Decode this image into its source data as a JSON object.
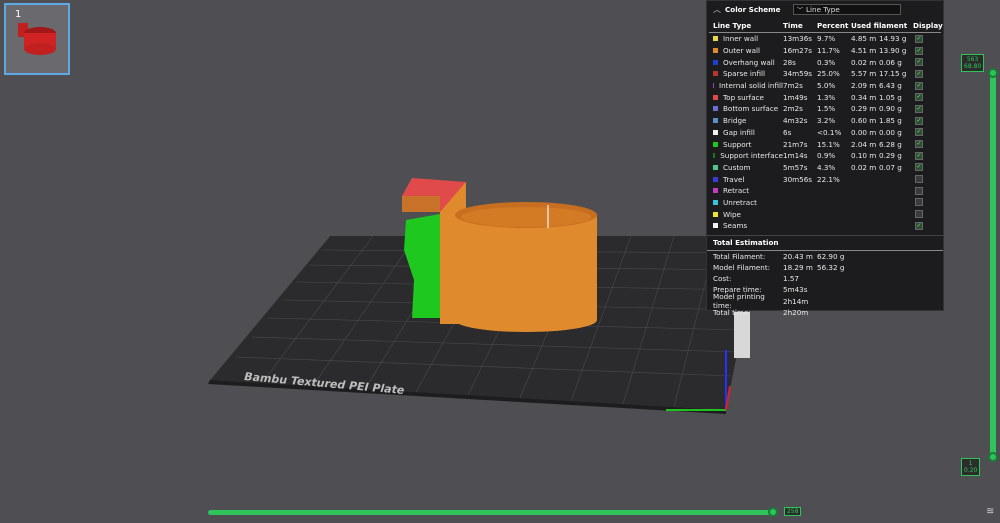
{
  "thumbnail": {
    "plate_number": "1"
  },
  "bed": {
    "label": "Bambu Textured PEI Plate"
  },
  "panel": {
    "color_scheme_label": "Color Scheme",
    "color_scheme_value": "Line Type",
    "columns": {
      "type": "Line Type",
      "time": "Time",
      "percent": "Percent",
      "filament": "Used filament",
      "display": "Display"
    },
    "rows": [
      {
        "name": "Inner wall",
        "time": "13m36s",
        "pct": "9.7%",
        "m": "4.85 m",
        "g": "14.93 g",
        "color": "#e8d84a",
        "on": true
      },
      {
        "name": "Outer wall",
        "time": "16m27s",
        "pct": "11.7%",
        "m": "4.51 m",
        "g": "13.90 g",
        "color": "#e28a2f",
        "on": true
      },
      {
        "name": "Overhang wall",
        "time": "28s",
        "pct": "0.3%",
        "m": "0.02 m",
        "g": "0.06 g",
        "color": "#1f3fcf",
        "on": true
      },
      {
        "name": "Sparse infill",
        "time": "34m59s",
        "pct": "25.0%",
        "m": "5.57 m",
        "g": "17.15 g",
        "color": "#b8322e",
        "on": true
      },
      {
        "name": "Internal solid infill",
        "time": "7m2s",
        "pct": "5.0%",
        "m": "2.09 m",
        "g": "6.43 g",
        "color": "#a23ec4",
        "on": true
      },
      {
        "name": "Top surface",
        "time": "1m49s",
        "pct": "1.3%",
        "m": "0.34 m",
        "g": "1.05 g",
        "color": "#e04a4a",
        "on": true
      },
      {
        "name": "Bottom surface",
        "time": "2m2s",
        "pct": "1.5%",
        "m": "0.29 m",
        "g": "0.90 g",
        "color": "#6c6cd8",
        "on": true
      },
      {
        "name": "Bridge",
        "time": "4m32s",
        "pct": "3.2%",
        "m": "0.60 m",
        "g": "1.85 g",
        "color": "#5c8fc8",
        "on": true
      },
      {
        "name": "Gap infill",
        "time": "6s",
        "pct": "<0.1%",
        "m": "0.00 m",
        "g": "0.00 g",
        "color": "#f2f2f2",
        "on": true
      },
      {
        "name": "Support",
        "time": "21m7s",
        "pct": "15.1%",
        "m": "2.04 m",
        "g": "6.28 g",
        "color": "#1ec81e",
        "on": true
      },
      {
        "name": "Support interface",
        "time": "1m14s",
        "pct": "0.9%",
        "m": "0.10 m",
        "g": "0.29 g",
        "color": "#1a7a1a",
        "on": true
      },
      {
        "name": "Custom",
        "time": "5m57s",
        "pct": "4.3%",
        "m": "0.02 m",
        "g": "0.07 g",
        "color": "#4fc88a",
        "on": true
      },
      {
        "name": "Travel",
        "time": "30m56s",
        "pct": "22.1%",
        "m": "",
        "g": "",
        "color": "#3a3ad8",
        "on": false
      },
      {
        "name": "Retract",
        "time": "",
        "pct": "",
        "m": "",
        "g": "",
        "color": "#c43ac4",
        "on": false
      },
      {
        "name": "Unretract",
        "time": "",
        "pct": "",
        "m": "",
        "g": "",
        "color": "#3ac4d8",
        "on": false
      },
      {
        "name": "Wipe",
        "time": "",
        "pct": "",
        "m": "",
        "g": "",
        "color": "#f0e030",
        "on": false
      },
      {
        "name": "Seams",
        "time": "",
        "pct": "",
        "m": "",
        "g": "",
        "color": "#f2f2f2",
        "on": true
      }
    ],
    "total_estimation_title": "Total Estimation",
    "totals": [
      {
        "k": "Total Filament:",
        "v1": "20.43 m",
        "v2": "62.90 g"
      },
      {
        "k": "Model Filament:",
        "v1": "18.29 m",
        "v2": "56.32 g"
      },
      {
        "k": "Cost:",
        "v1": "1.57",
        "v2": ""
      },
      {
        "k": "Prepare time:",
        "v1": "5m43s",
        "v2": ""
      },
      {
        "k": "Model printing time:",
        "v1": "2h14m",
        "v2": ""
      },
      {
        "k": "Total time:",
        "v1": "2h20m",
        "v2": ""
      }
    ]
  },
  "layer_slider": {
    "top_layer": "563",
    "top_height": "68.80",
    "bottom_layer": "1",
    "bottom_height": "0.20"
  },
  "move_slider": {
    "value": "258"
  },
  "colors": {
    "accent": "#2ec45a"
  }
}
